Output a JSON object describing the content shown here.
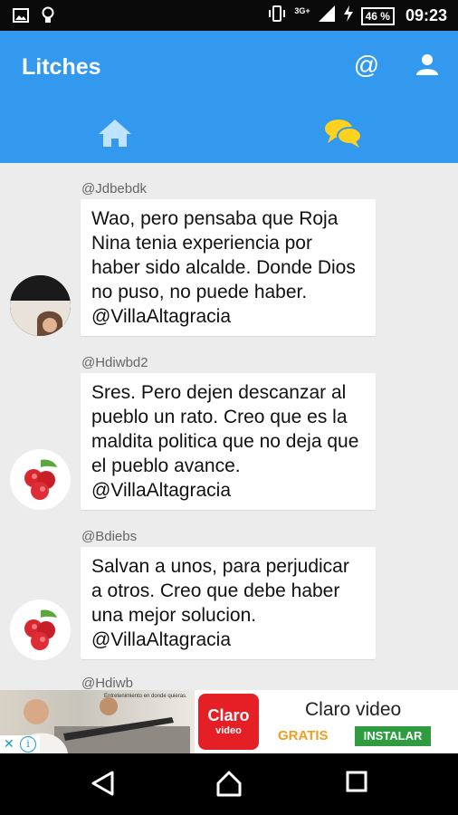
{
  "status_bar": {
    "network": "3G+",
    "battery": "46 %",
    "time": "09:23"
  },
  "app": {
    "title": "Litches"
  },
  "messages": [
    {
      "author": "@Jdbebdk",
      "text": "Wao, pero pensaba que Roja Nina tenia experiencia por haber sido alcalde. Donde Dios no puso, no puede haber. @VillaAltagracia",
      "avatar": "photo"
    },
    {
      "author": "@Hdiwbd2",
      "text": "Sres. Pero dejen descanzar al pueblo un rato. Creo que es la maldita politica que no deja que el pueblo avance. @VillaAltagracia",
      "avatar": "lychee"
    },
    {
      "author": "@Bdiebs",
      "text": "Salvan a unos, para perjudicar a otros. Creo que debe haber una mejor solucion. @VillaAltagracia",
      "avatar": "lychee"
    },
    {
      "author": "@Hdiwb"
    }
  ],
  "ad": {
    "logo_text": "Claro",
    "logo_sub": "video",
    "tagline": "Entretenimiento en donde quieras.",
    "title": "Claro video",
    "free_label": "GRATIS",
    "install_label": "INSTALAR"
  },
  "colors": {
    "primary": "#3399ee",
    "accent_yellow": "#ffd21f",
    "background": "#ececec"
  }
}
